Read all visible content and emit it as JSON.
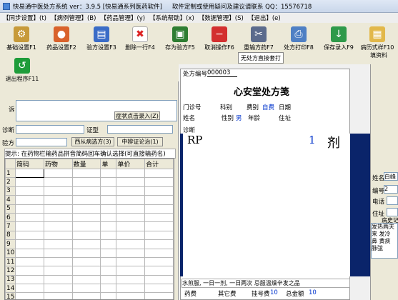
{
  "window": {
    "title": "快易通中医处方系统 ver：3.9.5 [快易通系列医药软件]",
    "support": "软件定制或使用疑问及建议请联系 QQ：15576718"
  },
  "menu": [
    "【同步设置】(t)",
    "【病例管理】(B)",
    "【药品管理】(y)",
    "【系统帮助】(x)",
    "【数据管理】(S)",
    "【退出】(e)"
  ],
  "toolbar": {
    "base": "基础设置F1",
    "drug": "药品设置F2",
    "rx_settings": "验方设置F3",
    "delete_row": "删除一行F4",
    "save_rx": "存为验方F5",
    "cancel": "取消操作F6",
    "reorder": "重输方药F7",
    "print": "处方打印F8",
    "save_entry": "保存录入F9",
    "style": "病历式样F10",
    "exit": "退出程序F11",
    "no_rx_print": "无处方直接套打",
    "fill_info": "填资料"
  },
  "left": {
    "complaint_label": "诉",
    "symptom_btn": "症状点击录入(Z)",
    "diagnosis_label": "诊断",
    "syndrome_label": "证型",
    "rx_label": "验方",
    "western_btn": "西从病选方(3)",
    "tcm_btn": "中辨证论治(1)",
    "hint": "提示: 在药物栏输药品拼音简码回车确认选择(可直接输药名)"
  },
  "grid": {
    "headers": [
      "",
      "简码",
      "药物",
      "数量",
      "单",
      "单价",
      "合计"
    ],
    "rows": [
      "1",
      "2",
      "3",
      "4",
      "5",
      "6",
      "7",
      "8",
      "9",
      "10",
      "11",
      "12",
      "13",
      "14",
      "15"
    ]
  },
  "rx": {
    "no_label": "处方编号",
    "no_value": "000003",
    "title": "心安堂处方笺",
    "clinic": "门诊号",
    "dept": "科别",
    "fee_label": "费别",
    "fee_value": "自费",
    "date": "日期",
    "name": "姓名",
    "sex_label": "性别",
    "sex_value": "男",
    "age": "年龄",
    "addr": "住址",
    "diag": "诊断",
    "rp": "RP",
    "qty": "1",
    "unit": "剂",
    "usage": "水煎服, 一日一剂, 一日两次 忌服温燥辛发之品",
    "drug_fee": "药费",
    "other_fee": "其它费",
    "reg_label": "挂号费",
    "reg_value": "10",
    "total_label": "总金额",
    "total_value": "10"
  },
  "right": {
    "name": "姓名",
    "name_value": "白峰",
    "num": "编号",
    "num_value": "2",
    "phone": "电话",
    "addr": "住址",
    "history": "病史记",
    "notes": "发热两天 来 发冷 鼻 黄痰 脉弦"
  }
}
